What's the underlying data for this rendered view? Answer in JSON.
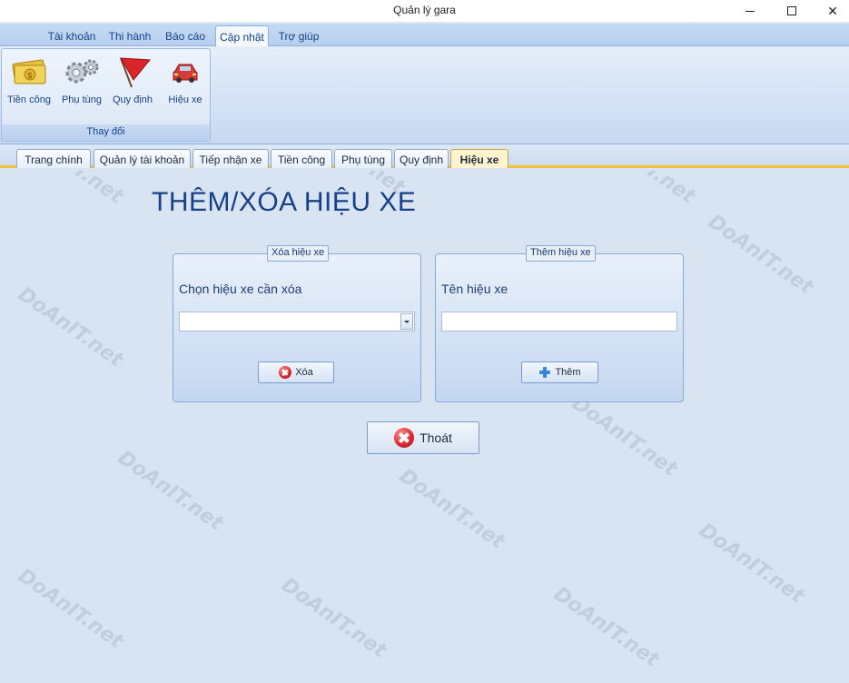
{
  "window": {
    "title": "Quản lý gara",
    "minimize_glyph": "",
    "maximize_glyph": "",
    "close_glyph": "✕"
  },
  "ribbon": {
    "tabs": [
      {
        "label": "Tài khoản"
      },
      {
        "label": "Thi hành"
      },
      {
        "label": "Báo cáo"
      },
      {
        "label": "Cập nhật",
        "active": true
      },
      {
        "label": "Trợ giúp"
      }
    ],
    "group_caption": "Thay đổi",
    "buttons": [
      {
        "label": "Tiền công",
        "icon": "money-icon"
      },
      {
        "label": "Phụ tùng",
        "icon": "gears-icon"
      },
      {
        "label": "Quy định",
        "icon": "flag-icon"
      },
      {
        "label": "Hiệu xe",
        "icon": "car-icon"
      }
    ]
  },
  "doc_tabs": [
    {
      "label": "Trang chính"
    },
    {
      "label": "Quản lý tài khoản"
    },
    {
      "label": "Tiếp nhận xe"
    },
    {
      "label": "Tiền công"
    },
    {
      "label": "Phụ tùng"
    },
    {
      "label": "Quy định"
    },
    {
      "label": "Hiệu xe",
      "active": true
    }
  ],
  "page": {
    "title": "THÊM/XÓA HIỆU XE",
    "delete_panel": {
      "legend": "Xóa hiệu xe",
      "label": "Chọn hiệu xe cần xóa",
      "selected_value": "",
      "button_label": "Xóa"
    },
    "add_panel": {
      "legend": "Thêm hiệu xe",
      "label": "Tên hiệu xe",
      "input_value": "",
      "button_label": "Thêm"
    },
    "exit_button_label": "Thoát"
  },
  "watermark": "DoAnIT.net",
  "colors": {
    "accent_tab_underline": "#f3c13c",
    "title_blue": "#17408a",
    "background": "#d9e4f2"
  }
}
